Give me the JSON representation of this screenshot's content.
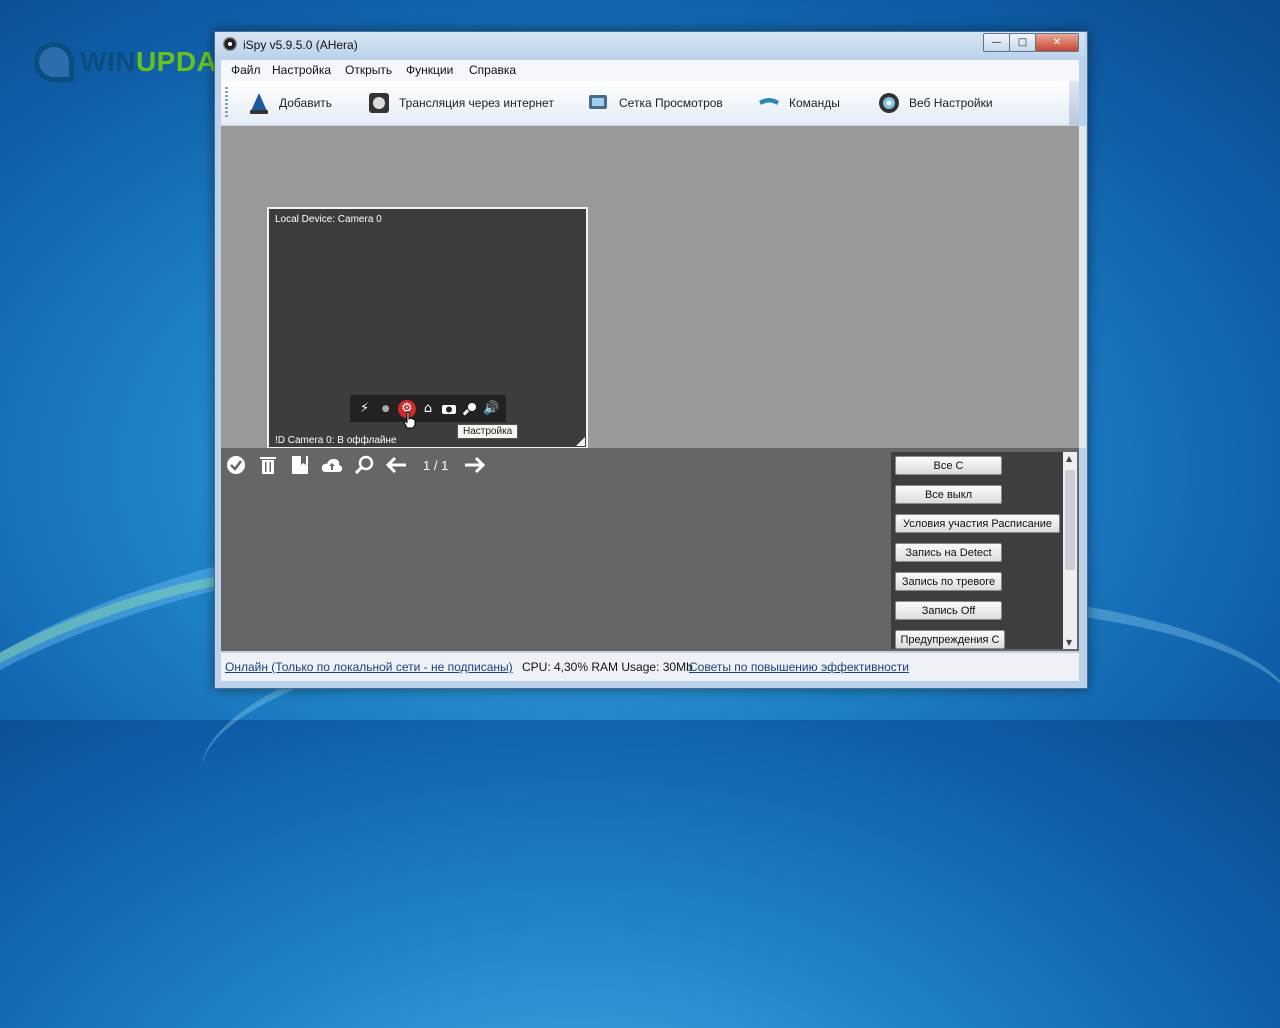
{
  "watermark": {
    "brand_left": "WIN",
    "brand_right": "UPDATE"
  },
  "window": {
    "title": "iSpy v5.9.5.0 (AHera)",
    "controls": {
      "minimize": "—",
      "maximize": "□",
      "close": "✕"
    }
  },
  "menu": [
    "Файл",
    "Настройка",
    "Открыть",
    "Функции",
    "Справка"
  ],
  "toolbar": [
    {
      "label": "Добавить",
      "icon": "add-camera-icon"
    },
    {
      "label": "Трансляция через интернет",
      "icon": "broadcast-icon"
    },
    {
      "label": "Сетка Просмотров",
      "icon": "grid-view-icon"
    },
    {
      "label": "Команды",
      "icon": "commands-icon"
    },
    {
      "label": "Веб Настройки",
      "icon": "web-settings-icon"
    }
  ],
  "camera": {
    "title": "Local Device: Camera 0",
    "status": "!D  Camera 0: В оффлайне",
    "controls": [
      "lightning-icon",
      "record-dot-icon",
      "settings-gear-icon",
      "home-icon",
      "camera-snapshot-icon",
      "microphone-icon",
      "speaker-icon"
    ],
    "tooltip": "Настройка"
  },
  "bottom_toolbar": {
    "icons": [
      "check-icon",
      "trash-icon",
      "bookmark-icon",
      "cloud-upload-icon",
      "search-icon",
      "arrow-left-icon"
    ],
    "pager": "1 / 1",
    "next_icon": "arrow-right-icon"
  },
  "actions": [
    "Все С",
    "Все выкл",
    "Условия участия Расписание",
    "Запись на Detect",
    "Запись по тревоге",
    "Запись Off",
    "Предупреждения С"
  ],
  "statusbar": {
    "online": "Онлайн (Только по локальной сети - не подписаны)",
    "stats": "CPU: 4,30% RAM Usage: 30Mb",
    "tips": "Советы по повышению эффективности"
  }
}
